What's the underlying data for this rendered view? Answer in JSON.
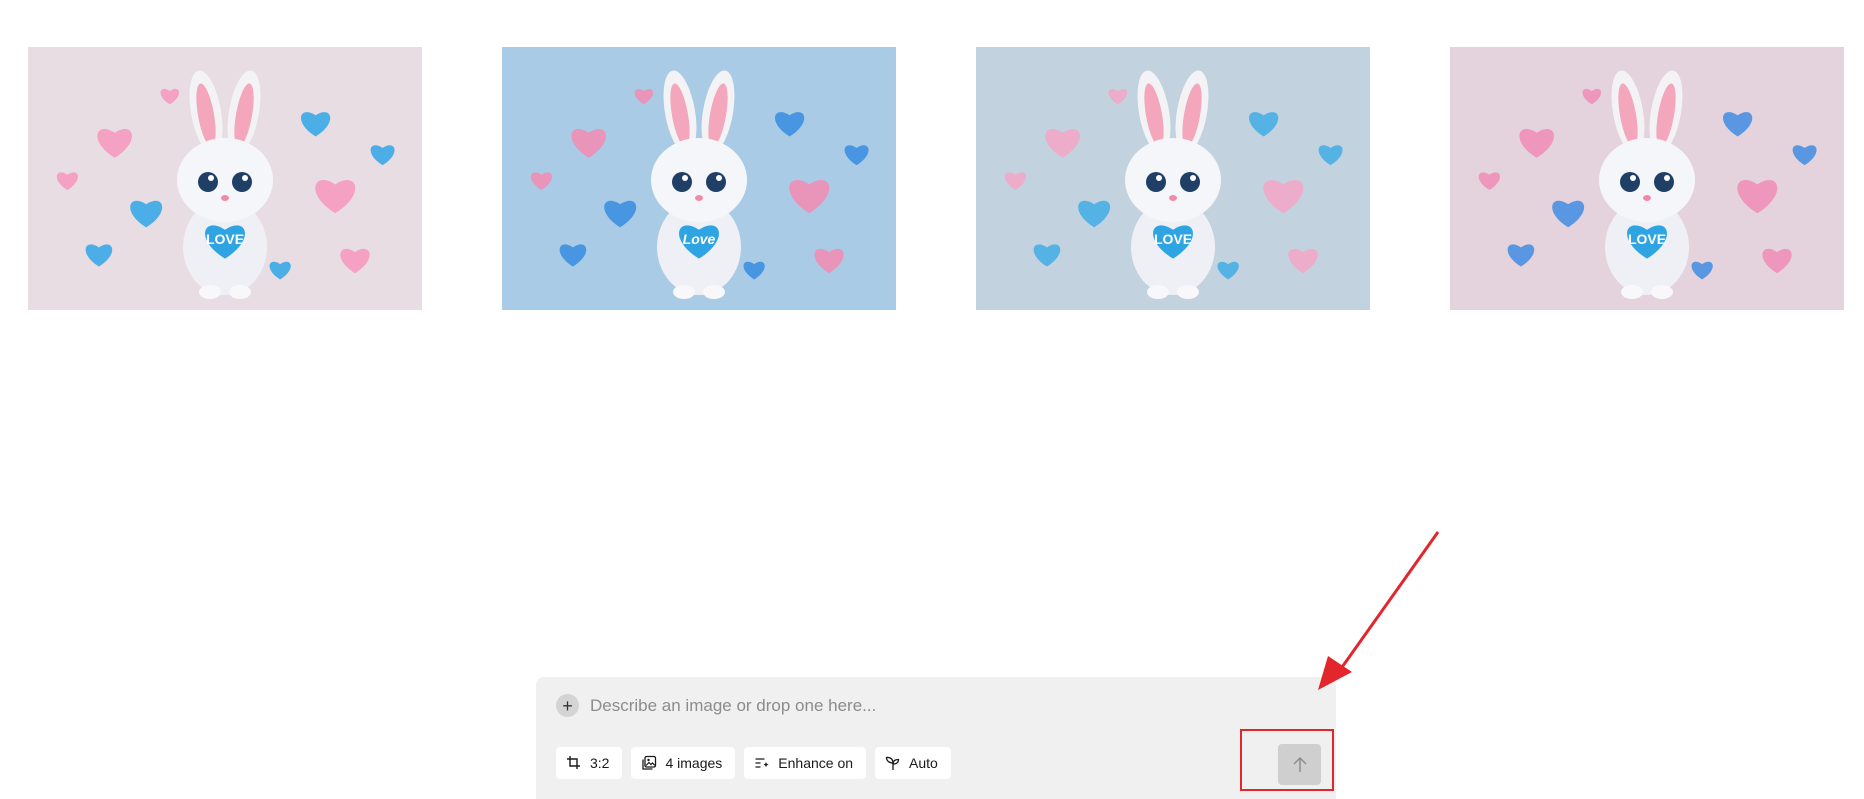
{
  "gallery": {
    "images": [
      {
        "caption": "LOVE",
        "background": "#e8dde2",
        "heart_colors": [
          "#f59ac0",
          "#3ba9e8"
        ]
      },
      {
        "caption": "Love",
        "background": "#a9cbe6",
        "heart_colors": [
          "#f08fb4",
          "#3d8fe0"
        ]
      },
      {
        "caption": "LOVE",
        "background": "#c3d2df",
        "heart_colors": [
          "#f2a7c6",
          "#48aee6"
        ]
      },
      {
        "caption": "LOVE",
        "background": "#e4d2dc",
        "heart_colors": [
          "#f08fb8",
          "#4a90e2"
        ]
      }
    ]
  },
  "composer": {
    "add_icon": "plus-icon",
    "placeholder": "Describe an image or drop one here...",
    "value": "",
    "options": [
      {
        "icon": "crop-icon",
        "label": "3:2"
      },
      {
        "icon": "images-icon",
        "label": "4 images"
      },
      {
        "icon": "enhance-icon",
        "label": "Enhance on"
      },
      {
        "icon": "sprout-icon",
        "label": "Auto"
      }
    ],
    "send_icon": "arrow-up-icon"
  },
  "annotation": {
    "color": "#e2262c",
    "target": "send-button"
  }
}
